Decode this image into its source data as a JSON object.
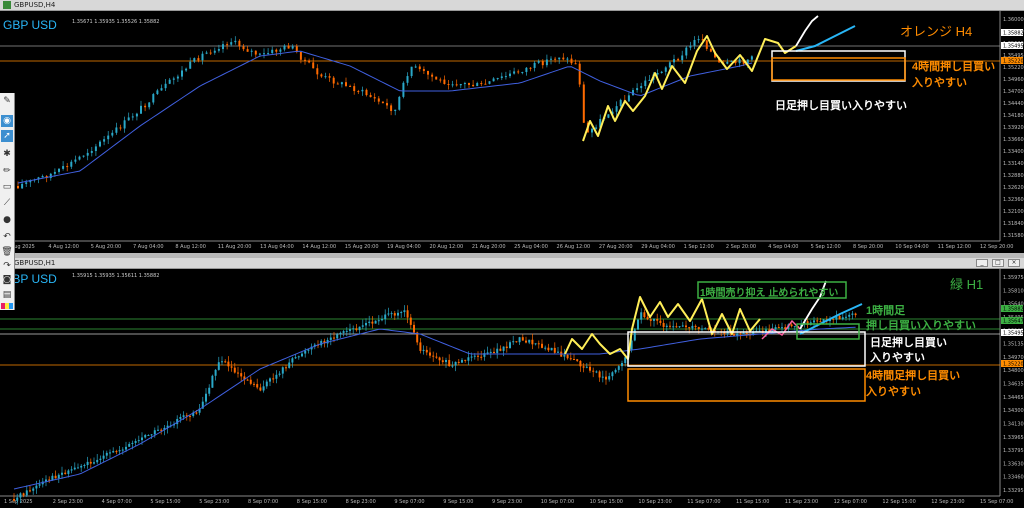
{
  "top_window": {
    "title": "GBPUSD,H4",
    "symbol": "GBP USD",
    "info": "1.35671 1.35935 1.35526 1.35882",
    "label_tf": "オレンジ H4",
    "annotations": [
      {
        "text": "4時間押し目買い",
        "color": "#ff8c00"
      },
      {
        "text": "入りやすい",
        "color": "#ff8c00"
      },
      {
        "text": "日足押し目買い入りやすい",
        "color": "#ffffff"
      }
    ],
    "price_labels": [
      "1.36000",
      "1.35880",
      "1.35620",
      "1.35495",
      "1.35220",
      "1.34960",
      "1.34700",
      "1.34440",
      "1.34180",
      "1.33920",
      "1.33660",
      "1.33400",
      "1.33140",
      "1.32880",
      "1.32620",
      "1.32360",
      "1.32100",
      "1.31840",
      "1.31580"
    ],
    "right_tags": [
      {
        "text": "1.35882",
        "bg": "#ffffff",
        "fg": "#000000"
      },
      {
        "text": "1.35495",
        "bg": "#ffffff",
        "fg": "#000000"
      },
      {
        "text": "1.35220",
        "bg": "#ff8c00",
        "fg": "#000000"
      }
    ],
    "time_labels": [
      "4 Aug 2025",
      "4 Aug 12:00",
      "5 Aug 20:00",
      "7 Aug 04:00",
      "8 Aug 12:00",
      "11 Aug 20:00",
      "13 Aug 04:00",
      "14 Aug 12:00",
      "15 Aug 20:00",
      "19 Aug 04:00",
      "20 Aug 12:00",
      "21 Aug 20:00",
      "25 Aug 04:00",
      "26 Aug 12:00",
      "27 Aug 20:00",
      "29 Aug 04:00",
      "1 Sep 12:00",
      "2 Sep 20:00",
      "4 Sep 04:00",
      "5 Sep 12:00",
      "8 Sep 20:00",
      "10 Sep 04:00",
      "11 Sep 12:00",
      "12 Sep 20:00"
    ]
  },
  "bottom_window": {
    "title": "GBPUSD,H1",
    "symbol": "GBP USD",
    "info": "1.35915 1.35935 1.35611 1.35882",
    "label_tf": "緑 H1",
    "annotations": [
      {
        "text": "1時間売り抑え 止められやすい",
        "color": "#3cb043"
      },
      {
        "text": "1時間足",
        "color": "#3cb043"
      },
      {
        "text": "押し目買い入りやすい",
        "color": "#3cb043"
      },
      {
        "text": "日足押し目買い",
        "color": "#ffffff"
      },
      {
        "text": "入りやすい",
        "color": "#ffffff"
      },
      {
        "text": "4時間足押し目買い",
        "color": "#ff8c00"
      },
      {
        "text": "入りやすい",
        "color": "#ff8c00"
      }
    ],
    "price_labels": [
      "1.35975",
      "1.35810",
      "1.35640",
      "1.35495",
      "1.35305",
      "1.35135",
      "1.34970",
      "1.34800",
      "1.34635",
      "1.34465",
      "1.34300",
      "1.34130",
      "1.33965",
      "1.33795",
      "1.33630",
      "1.33460",
      "1.33295"
    ],
    "right_tags": [
      {
        "text": "1.35882",
        "bg": "#3cb043",
        "fg": "#000000"
      },
      {
        "text": "1.35647",
        "bg": "#3cb043",
        "fg": "#000000"
      },
      {
        "text": "1.35495",
        "bg": "#ffffff",
        "fg": "#000000"
      },
      {
        "text": "1.35220",
        "bg": "#ff8c00",
        "fg": "#000000"
      }
    ],
    "time_labels": [
      "1 Sep 2025",
      "2 Sep 23:00",
      "4 Sep 07:00",
      "5 Sep 15:00",
      "5 Sep 23:00",
      "8 Sep 07:00",
      "8 Sep 15:00",
      "8 Sep 23:00",
      "9 Sep 07:00",
      "9 Sep 15:00",
      "9 Sep 23:00",
      "10 Sep 07:00",
      "10 Sep 15:00",
      "10 Sep 23:00",
      "11 Sep 07:00",
      "11 Sep 15:00",
      "11 Sep 23:00",
      "12 Sep 07:00",
      "12 Sep 15:00",
      "12 Sep 23:00",
      "15 Sep 07:00"
    ]
  },
  "toolbar_icons": [
    "pin-icon",
    "eye-icon",
    "pointer-icon",
    "gear-icon",
    "pencil-icon",
    "rectangle-icon",
    "ruler-icon",
    "dot-icon",
    "undo-icon",
    "trash-icon",
    "redo-icon",
    "camera-icon",
    "document-icon",
    "palette-icon"
  ],
  "colors": {
    "bull": "#2aa8c8",
    "bear": "#ff6a00",
    "ma": "#4060e0",
    "zigzag": "#ffee58",
    "trend": "#29b6f6",
    "orange": "#ff8c00",
    "green": "#3cb043",
    "grid": "#4a4a4a"
  }
}
